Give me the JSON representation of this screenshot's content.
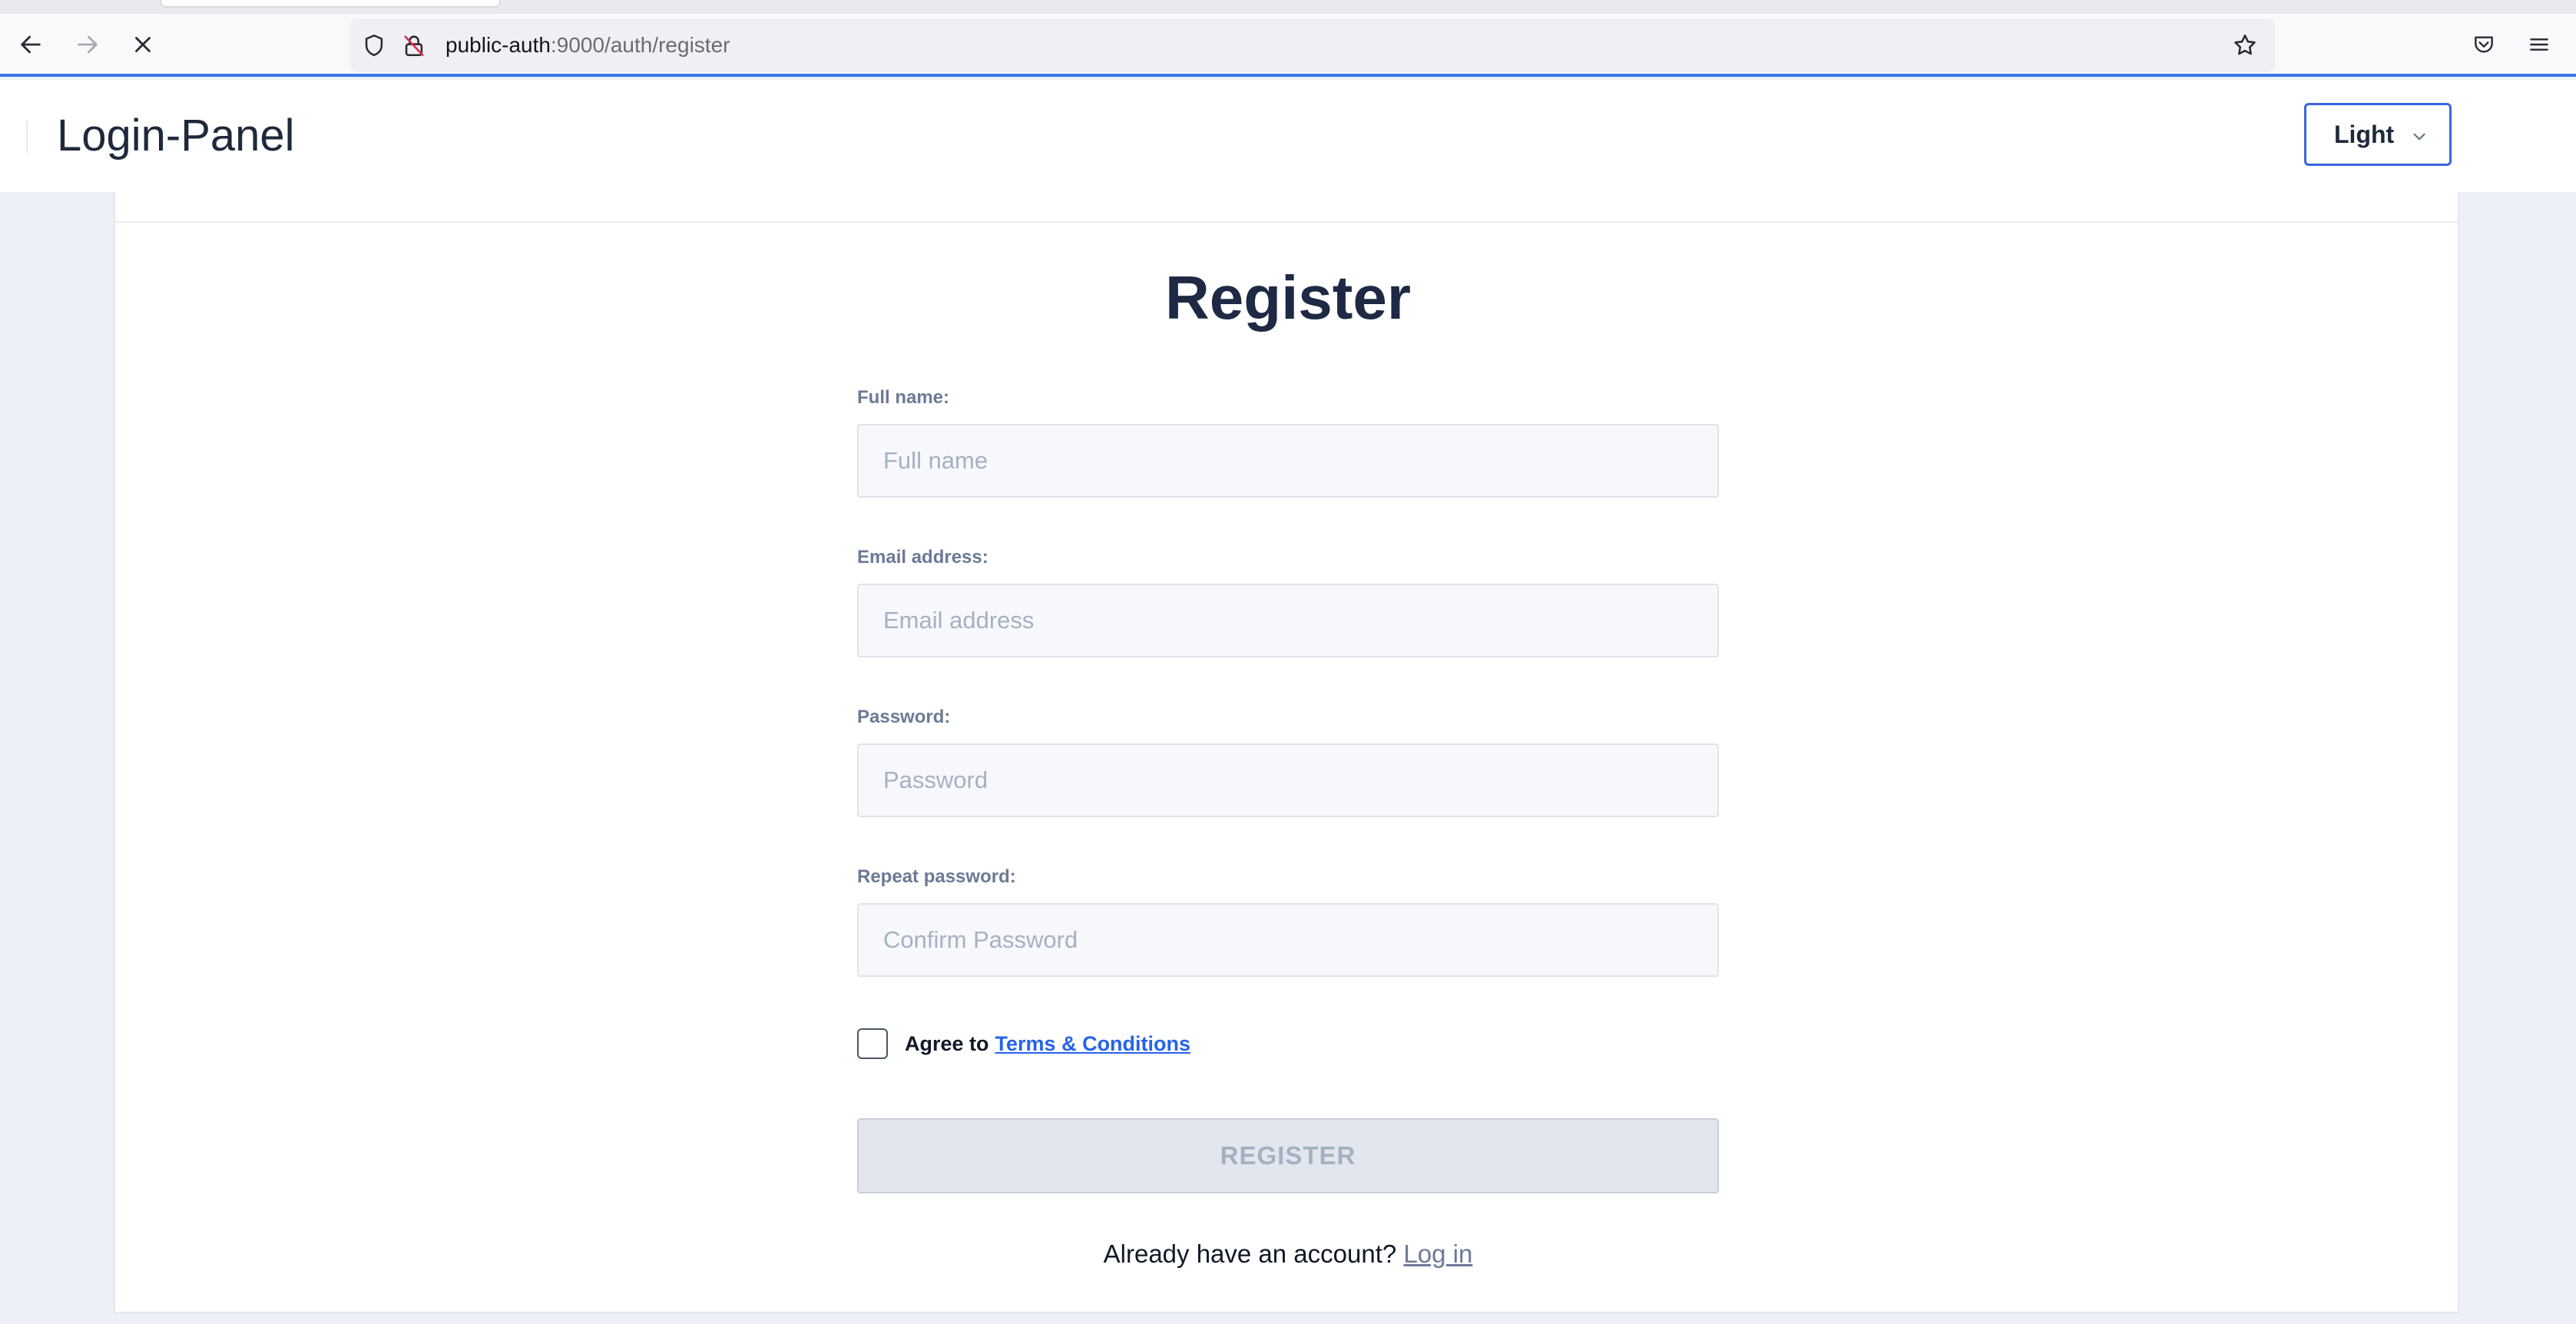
{
  "browser": {
    "url_host": "public-auth",
    "url_rest": ":9000/auth/register"
  },
  "app": {
    "brand": "Login-Panel",
    "theme_value": "Light"
  },
  "form": {
    "title": "Register",
    "fields": [
      {
        "label": "Full name:",
        "placeholder": "Full name",
        "value": ""
      },
      {
        "label": "Email address:",
        "placeholder": "Email address",
        "value": ""
      },
      {
        "label": "Password:",
        "placeholder": "Password",
        "value": ""
      },
      {
        "label": "Repeat password:",
        "placeholder": "Confirm Password",
        "value": ""
      }
    ],
    "agree_text": "Agree to",
    "terms_link": "Terms & Conditions",
    "terms_checked": false,
    "submit_label": "REGISTER",
    "submit_enabled": false,
    "login_prompt": "Already have an account?",
    "login_link": "Log in"
  },
  "icons": {
    "back": "back-arrow-icon",
    "forward": "forward-arrow-icon",
    "stop": "stop-loading-icon",
    "shield": "tracking-protection-shield-icon",
    "lock": "insecure-lock-icon",
    "bookmark": "bookmark-star-icon",
    "pocket": "pocket-icon",
    "menu": "hamburger-menu-icon",
    "theme_dropdown": "chevron-down-icon"
  },
  "colors": {
    "accent": "#3b65e0",
    "link": "#2563eb",
    "page_bg": "#edf0f6",
    "title": "#1e2a44"
  }
}
